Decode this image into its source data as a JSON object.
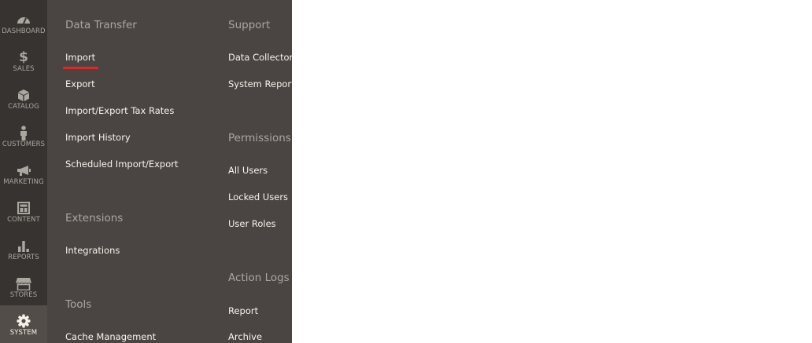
{
  "nav": {
    "items": [
      {
        "label": "DASHBOARD",
        "icon": "dashboard-icon"
      },
      {
        "label": "SALES",
        "icon": "dollar-icon"
      },
      {
        "label": "CATALOG",
        "icon": "cube-icon"
      },
      {
        "label": "CUSTOMERS",
        "icon": "person-icon"
      },
      {
        "label": "MARKETING",
        "icon": "megaphone-icon"
      },
      {
        "label": "CONTENT",
        "icon": "layout-icon"
      },
      {
        "label": "REPORTS",
        "icon": "bar-chart-icon"
      },
      {
        "label": "STORES",
        "icon": "storefront-icon"
      },
      {
        "label": "SYSTEM",
        "icon": "gear-icon"
      }
    ],
    "active": "SYSTEM"
  },
  "panel": {
    "left": {
      "data_transfer": {
        "title": "Data Transfer",
        "links": [
          "Import",
          "Export",
          "Import/Export Tax Rates",
          "Import History",
          "Scheduled Import/Export"
        ]
      },
      "extensions": {
        "title": "Extensions",
        "links": [
          "Integrations"
        ]
      },
      "tools": {
        "title": "Tools",
        "links": [
          "Cache Management"
        ]
      }
    },
    "right": {
      "support": {
        "title": "Support",
        "links": [
          "Data Collector",
          "System Report"
        ]
      },
      "permissions": {
        "title": "Permissions",
        "links": [
          "All Users",
          "Locked Users",
          "User Roles"
        ]
      },
      "action_logs": {
        "title": "Action Logs",
        "links": [
          "Report",
          "Archive"
        ]
      }
    },
    "selected_link": "Import",
    "selected_color": "#e22626"
  },
  "colors": {
    "nav_bg": "#373330",
    "panel_bg": "#4a4542",
    "heading": "#aaa6a0",
    "link": "#f7f3eb"
  }
}
